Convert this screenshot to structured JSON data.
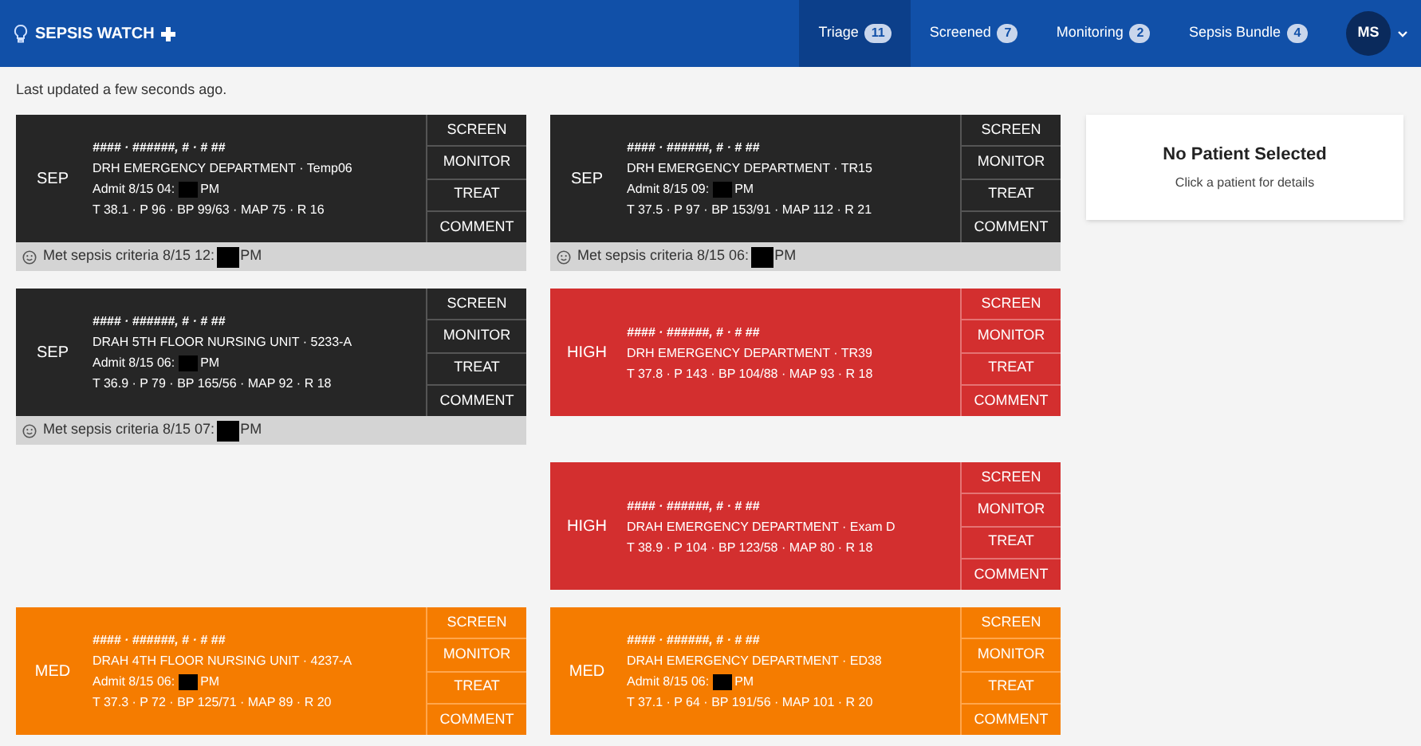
{
  "header": {
    "title": "SEPSIS WATCH"
  },
  "tabs": [
    {
      "label": "Triage",
      "count": "11",
      "selected": true
    },
    {
      "label": "Screened",
      "count": "7",
      "selected": false
    },
    {
      "label": "Monitoring",
      "count": "2",
      "selected": false
    },
    {
      "label": "Sepsis Bundle",
      "count": "4",
      "selected": false
    }
  ],
  "user": {
    "initials": "MS"
  },
  "status": "Last updated a few seconds ago.",
  "rows": [
    {
      "left": {
        "kind": "sep",
        "badge": "SEP",
        "name": "#### · ######, # · # ##",
        "location": "DRH EMERGENCY DEPARTMENT · Temp06",
        "admit": [
          "Admit 8/15 04:",
          "PM"
        ],
        "vitals": "T 38.1 · P 96 · BP 99/63 · MAP 75 · R 16",
        "actions": [
          "SCREEN",
          "MONITOR",
          "TREAT",
          "COMMENT"
        ],
        "criteria": [
          "Met sepsis criteria 8/15 12:",
          "PM"
        ]
      },
      "right": {
        "kind": "sep",
        "badge": "SEP",
        "name": "#### · ######, # · # ##",
        "location": "DRH EMERGENCY DEPARTMENT · TR15",
        "admit": [
          "Admit 8/15 09:",
          "PM"
        ],
        "vitals": "T 37.5 · P 97 · BP 153/91 · MAP 112 · R 21",
        "actions": [
          "SCREEN",
          "MONITOR",
          "TREAT",
          "COMMENT"
        ],
        "criteria": [
          "Met sepsis criteria 8/15 06:",
          "PM"
        ]
      }
    },
    {
      "left": {
        "kind": "sep",
        "badge": "SEP",
        "name": "#### · ######, # · # ##",
        "location": "DRAH 5TH FLOOR NURSING UNIT · 5233-A",
        "admit": [
          "Admit 8/15 06:",
          "PM"
        ],
        "vitals": "T 36.9 · P 79 · BP 165/56 · MAP 92 · R 18",
        "actions": [
          "SCREEN",
          "MONITOR",
          "TREAT",
          "COMMENT"
        ],
        "criteria": [
          "Met sepsis criteria 8/15 07:",
          "PM"
        ]
      },
      "right": {
        "kind": "high",
        "badge": "HIGH",
        "name": "#### · ######, # · # ##",
        "location": "DRH EMERGENCY DEPARTMENT · TR39",
        "vitals": "T 37.8 · P 143 · BP 104/88 · MAP 93 · R 18",
        "actions": [
          "SCREEN",
          "MONITOR",
          "TREAT",
          "COMMENT"
        ]
      }
    },
    {
      "right": {
        "kind": "high",
        "badge": "HIGH",
        "name": "#### · ######, # · # ##",
        "location": "DRAH EMERGENCY DEPARTMENT · Exam D",
        "vitals": "T 38.9 · P 104 · BP 123/58 · MAP 80 · R 18",
        "actions": [
          "SCREEN",
          "MONITOR",
          "TREAT",
          "COMMENT"
        ]
      }
    },
    {
      "left": {
        "kind": "med",
        "badge": "MED",
        "name": "#### · ######, # · # ##",
        "location": "DRAH 4TH FLOOR NURSING UNIT · 4237-A",
        "admit": [
          "Admit 8/15 06:",
          "PM"
        ],
        "vitals": "T 37.3 · P 72 · BP 125/71 · MAP 89 · R 20",
        "actions": [
          "SCREEN",
          "MONITOR",
          "TREAT",
          "COMMENT"
        ]
      },
      "right": {
        "kind": "med",
        "badge": "MED",
        "name": "#### · ######, # · # ##",
        "location": "DRAH EMERGENCY DEPARTMENT · ED38",
        "admit": [
          "Admit 8/15 06:",
          "PM"
        ],
        "vitals": "T 37.1 · P 64 · BP 191/56 · MAP 101 · R 20",
        "actions": [
          "SCREEN",
          "MONITOR",
          "TREAT",
          "COMMENT"
        ]
      }
    }
  ],
  "detail": {
    "title": "No Patient Selected",
    "hint": "Click a patient for details"
  }
}
